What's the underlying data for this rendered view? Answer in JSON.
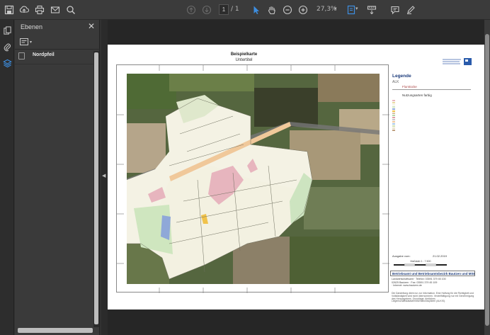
{
  "toolbar": {
    "page_current": "1",
    "page_total": "/ 1",
    "zoom": "27,3%",
    "icons": [
      "save-icon",
      "upload-icon",
      "print-icon",
      "mail-icon",
      "search-icon",
      "prev-page-icon",
      "next-page-icon",
      "select-tool-icon",
      "hand-tool-icon",
      "zoom-out-icon",
      "zoom-in-icon",
      "fit-page-icon",
      "measure-icon",
      "comment-icon",
      "pen-icon"
    ]
  },
  "panel": {
    "title": "Ebenen",
    "close_label": "✕",
    "layers": [
      {
        "label": "Nordpfeil"
      }
    ]
  },
  "map": {
    "title": "Beispielkarte",
    "subtitle": "Untertitel"
  },
  "legend": {
    "title": "Legende",
    "alk": "ALK",
    "flurstuecke": "Flurstücke",
    "nutzung": "Nutzungsarten farbig",
    "ausgabe_label": "Ausgabe vom:",
    "ausgabe_date": "21.02.2019",
    "scale": "Maßstab 1 : 7.500",
    "office": "Betriebsamt  und  Betriebsamtsbezirk Bautzen  und  MSB MBH",
    "contact_lines": [
      "Landwirtschaftsamt  ·  Telefon: 03591 379 45 100",
      "02625 Bautzen  ·  Fax: 03591 379 45 109",
      "                       ·  Internet: www.bautzen.de"
    ],
    "footer": "Die Darstellung dient nur zur Information. Eine Haftung für die Richtigkeit und Vollständigkeit wird nicht übernommen. Vervielfältigung nur mit Genehmigung des Herausgebers. Grundlage: Amtliches Liegenschaftskatasterinformationssystem (ALKIS)."
  },
  "colors": {
    "accent": "#3d8ee0",
    "toolbar_bg": "#3b3b3b",
    "legend_blue": "#1a3a7a"
  }
}
